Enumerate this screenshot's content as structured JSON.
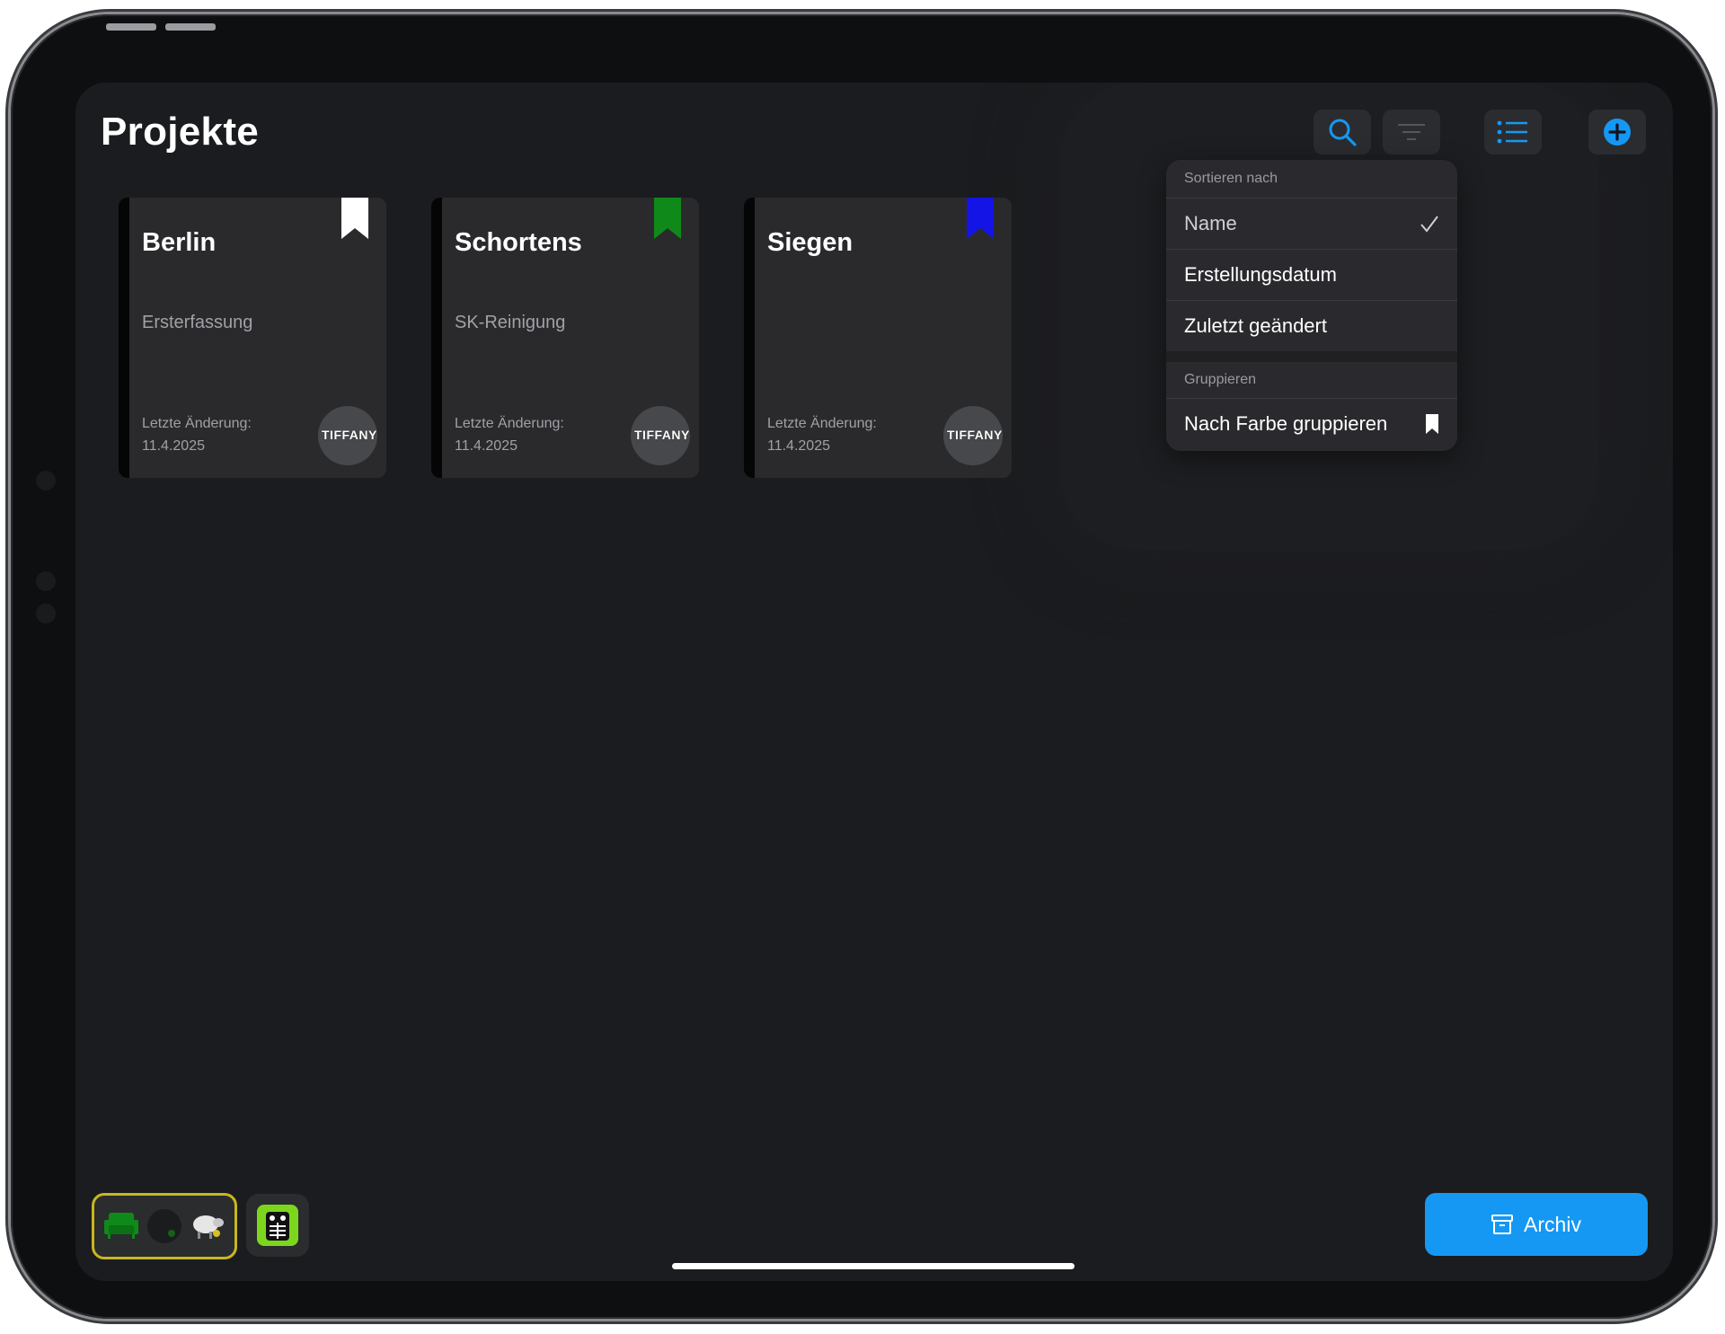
{
  "header": {
    "title": "Projekte"
  },
  "toolbar": {
    "search_icon": "magnifier-icon",
    "sort_icon": "sort-lines-icon",
    "list_icon": "list-bullets-icon",
    "add_icon": "plus-circle-icon",
    "accent_color": "#1598f4"
  },
  "projects": [
    {
      "name": "Berlin",
      "subtitle": "Ersterfassung",
      "modified_label": "Letzte Änderung:",
      "modified_date": "11.4.2025",
      "bookmark_color": "#ffffff",
      "logo_text": "TIFFANY"
    },
    {
      "name": "Schortens",
      "subtitle": "SK-Reinigung",
      "modified_label": "Letzte Änderung:",
      "modified_date": "11.4.2025",
      "bookmark_color": "#0f8a1a",
      "logo_text": "TIFFANY"
    },
    {
      "name": "Siegen",
      "subtitle": "",
      "modified_label": "Letzte Änderung:",
      "modified_date": "11.4.2025",
      "bookmark_color": "#1414e6",
      "logo_text": "TIFFANY"
    }
  ],
  "sort_menu": {
    "sort_header": "Sortieren nach",
    "options": [
      {
        "label": "Name",
        "selected": true
      },
      {
        "label": "Erstellungsdatum",
        "selected": false
      },
      {
        "label": "Zuletzt geändert",
        "selected": false
      }
    ],
    "group_header": "Gruppieren",
    "group_option": "Nach Farbe gruppieren",
    "checkmark_icon": "checkmark-icon",
    "bookmark_icon": "bookmark-icon"
  },
  "dock": {
    "app_group_icons": [
      "green-sofa-icon",
      "dark-circle-icon",
      "sheep-icon"
    ],
    "app_icon": "green-robot-icon",
    "group_border_color": "#c8b71e"
  },
  "footer": {
    "archive_label": "Archiv",
    "archive_icon": "archive-box-icon"
  }
}
